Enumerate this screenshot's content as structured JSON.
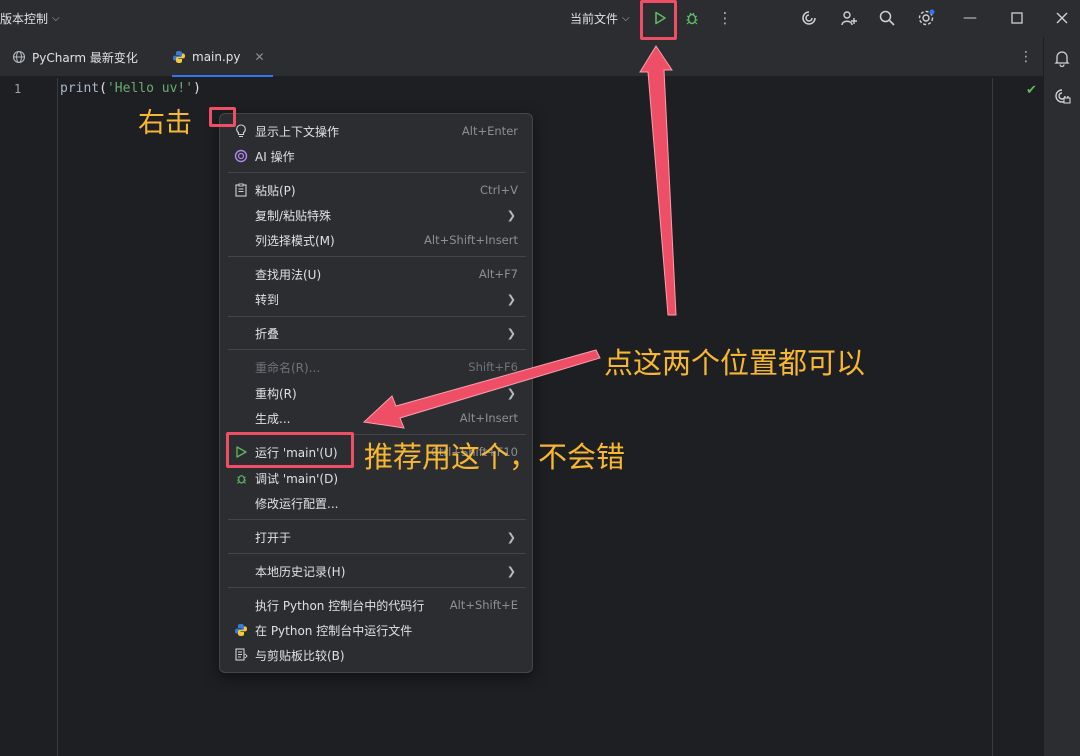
{
  "titlebar": {
    "vcs_label": "版本控制",
    "current_file_label": "当前文件"
  },
  "tabs": [
    {
      "label": "PyCharm 最新变化"
    },
    {
      "label": "main.py"
    }
  ],
  "editor": {
    "line_number": "1",
    "code": {
      "fn": "print",
      "open": "(",
      "str": "'Hello uv!'",
      "close": ")"
    }
  },
  "context_menu": {
    "items": [
      {
        "label": "显示上下文操作",
        "shortcut": "Alt+Enter",
        "icon": "bulb-icon"
      },
      {
        "label": "AI 操作",
        "icon": "ai-icon"
      },
      {
        "label": "粘贴(P)",
        "shortcut": "Ctrl+V",
        "icon": "paste-icon"
      },
      {
        "label": "复制/粘贴特殊",
        "submenu": true
      },
      {
        "label": "列选择模式(M)",
        "shortcut": "Alt+Shift+Insert"
      },
      {
        "label": "查找用法(U)",
        "shortcut": "Alt+F7"
      },
      {
        "label": "转到",
        "submenu": true
      },
      {
        "label": "折叠",
        "submenu": true
      },
      {
        "label": "重命名(R)...",
        "shortcut": "Shift+F6",
        "disabled": true
      },
      {
        "label": "重构(R)",
        "submenu": true
      },
      {
        "label": "生成...",
        "shortcut": "Alt+Insert"
      },
      {
        "label": "运行 'main'(U)",
        "shortcut": "Ctrl+Shift+F10",
        "icon": "run-icon"
      },
      {
        "label": "调试 'main'(D)",
        "icon": "debug-icon"
      },
      {
        "label": "修改运行配置..."
      },
      {
        "label": "打开于",
        "submenu": true
      },
      {
        "label": "本地历史记录(H)",
        "submenu": true
      },
      {
        "label": "执行 Python 控制台中的代码行",
        "shortcut": "Alt+Shift+E"
      },
      {
        "label": "在 Python 控制台中运行文件",
        "icon": "python-icon"
      },
      {
        "label": "与剪贴板比较(B)",
        "icon": "compare-icon"
      }
    ]
  },
  "annotations": {
    "right_click": "右击",
    "both_positions": "点这两个位置都可以",
    "recommend": "推荐用这个，不会错"
  },
  "colors": {
    "annotation": "#f7b731",
    "highlight_box": "#ee4f66",
    "run_green": "#5fb865"
  }
}
